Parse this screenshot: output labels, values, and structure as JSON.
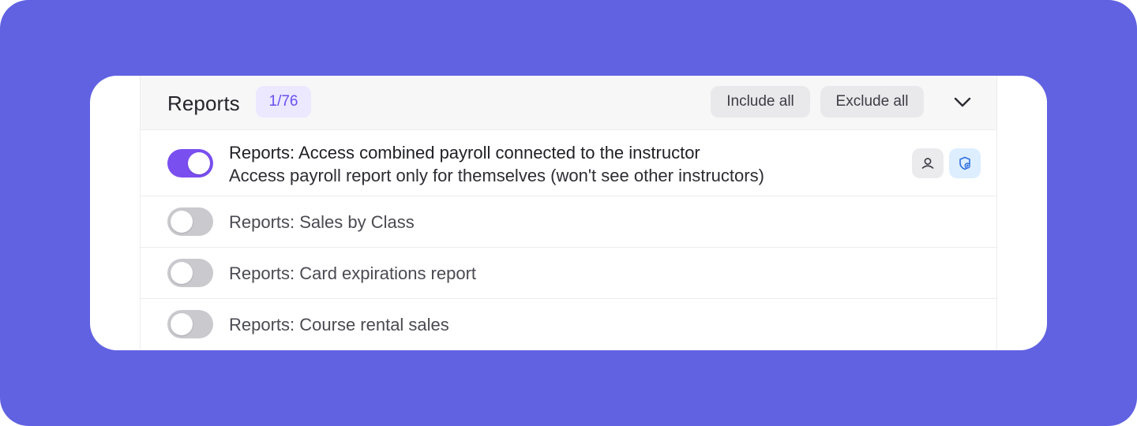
{
  "section": {
    "title": "Reports",
    "count_badge": "1/76",
    "include_all_label": "Include all",
    "exclude_all_label": "Exclude all",
    "collapse_icon": "chevron-down-icon"
  },
  "permissions": [
    {
      "title": "Reports: Access combined payroll connected to the instructor",
      "description": "Access payroll report only for themselves (won't see other instructors)",
      "enabled": true,
      "icons": [
        "user-icon",
        "shield-icon"
      ]
    },
    {
      "title": "Reports: Sales by Class",
      "enabled": false
    },
    {
      "title": "Reports: Card expirations report",
      "enabled": false
    },
    {
      "title": "Reports: Course rental sales",
      "enabled": false
    }
  ],
  "colors": {
    "background": "#6162e1",
    "accent": "#7a4ff0",
    "badge_bg": "#ebe8ff",
    "badge_text": "#6a4ef0",
    "toggle_off": "#c9c9ce",
    "shield_icon_bg": "#dceeff",
    "shield_icon": "#2f6fe0"
  }
}
